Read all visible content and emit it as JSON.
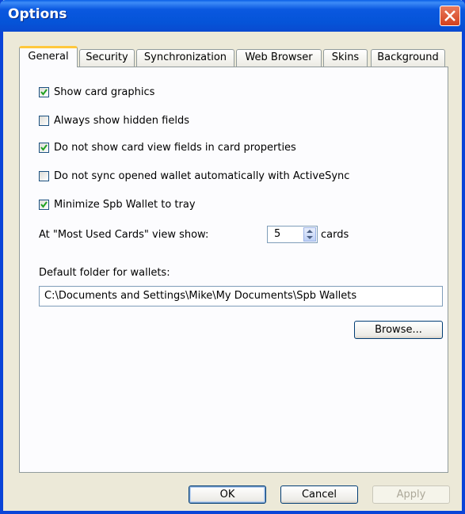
{
  "window": {
    "title": "Options"
  },
  "tabs": [
    {
      "label": "General",
      "active": true
    },
    {
      "label": "Security",
      "active": false
    },
    {
      "label": "Synchronization",
      "active": false
    },
    {
      "label": "Web Browser",
      "active": false
    },
    {
      "label": "Skins",
      "active": false
    },
    {
      "label": "Background",
      "active": false
    }
  ],
  "general": {
    "options": [
      {
        "label": "Show card graphics",
        "checked": true
      },
      {
        "label": "Always show hidden fields",
        "checked": false
      },
      {
        "label": "Do not show card view fields in card properties",
        "checked": true
      },
      {
        "label": "Do not sync opened wallet automatically with ActiveSync",
        "checked": false
      },
      {
        "label": "Minimize Spb Wallet to tray",
        "checked": true
      }
    ],
    "most_used": {
      "label": "At \"Most Used Cards\" view show:",
      "value": "5",
      "unit": "cards"
    },
    "folder": {
      "label": "Default folder for wallets:",
      "value": "C:\\Documents and Settings\\Mike\\My Documents\\Spb Wallets"
    },
    "browse_label": "Browse..."
  },
  "footer": {
    "ok_label": "OK",
    "cancel_label": "Cancel",
    "apply_label": "Apply"
  },
  "colors": {
    "titlebar": "#0554d8",
    "dialog_bg": "#ece9d8",
    "active_tab_accent": "#ffc83c",
    "check_mark": "#21a121"
  }
}
